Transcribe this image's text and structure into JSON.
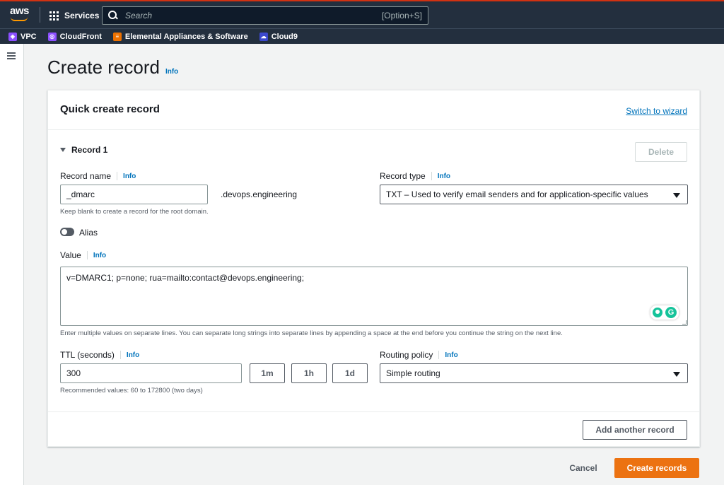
{
  "topnav": {
    "logo": "aws",
    "services_label": "Services",
    "search_placeholder": "Search",
    "search_shortcut": "[Option+S]"
  },
  "favorites": [
    {
      "label": "VPC",
      "icon": "vpc-icon",
      "color": "#8c4fff"
    },
    {
      "label": "CloudFront",
      "icon": "cloudfront-icon",
      "color": "#8c4fff"
    },
    {
      "label": "Elemental Appliances & Software",
      "icon": "elemental-icon",
      "color": "#ed7100"
    },
    {
      "label": "Cloud9",
      "icon": "cloud9-icon",
      "color": "#3b48cc"
    }
  ],
  "page": {
    "title": "Create record",
    "title_info": "Info"
  },
  "card": {
    "title": "Quick create record",
    "switch_link": "Switch to wizard",
    "record_toggle": "Record 1",
    "delete_label": "Delete",
    "record_name": {
      "label": "Record name",
      "info": "Info",
      "value": "_dmarc",
      "suffix": ".devops.engineering",
      "hint": "Keep blank to create a record for the root domain."
    },
    "record_type": {
      "label": "Record type",
      "info": "Info",
      "value": "TXT – Used to verify email senders and for application-specific values"
    },
    "alias": {
      "label": "Alias",
      "enabled": false
    },
    "value": {
      "label": "Value",
      "info": "Info",
      "text": "v=DMARC1; p=none; rua=mailto:contact@devops.engineering;",
      "hint": "Enter multiple values on separate lines. You can separate long strings into separate lines by appending a space at the end before you continue the string on the next line."
    },
    "ttl": {
      "label": "TTL (seconds)",
      "info": "Info",
      "value": "300",
      "hint": "Recommended values: 60 to 172800 (two days)",
      "presets": [
        "1m",
        "1h",
        "1d"
      ]
    },
    "routing": {
      "label": "Routing policy",
      "info": "Info",
      "value": "Simple routing"
    },
    "add_another": "Add another record"
  },
  "actions": {
    "cancel": "Cancel",
    "create": "Create records"
  },
  "colors": {
    "nav_bg": "#232f3e",
    "primary": "#ec7211",
    "link": "#0073bb"
  }
}
